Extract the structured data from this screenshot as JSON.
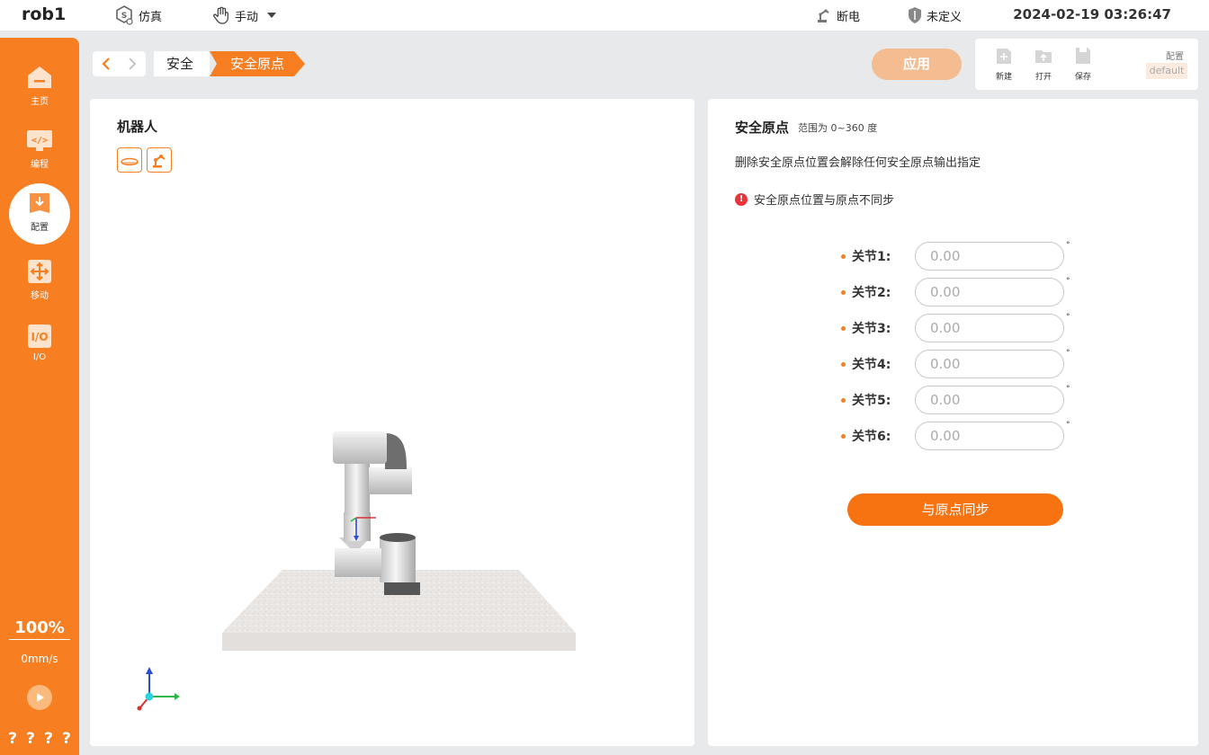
{
  "topbar": {
    "robot_name": "rob1",
    "mode_label": "仿真",
    "control_label": "手动",
    "power_label": "断电",
    "safety_label": "未定义",
    "datetime": "2024-02-19 03:26:47"
  },
  "sidebar": {
    "items": [
      {
        "label": "主页",
        "icon": "home-icon"
      },
      {
        "label": "编程",
        "icon": "code-icon"
      },
      {
        "label": "配置",
        "icon": "config-icon"
      },
      {
        "label": "移动",
        "icon": "move-icon"
      },
      {
        "label": "I/O",
        "icon": "io-icon"
      }
    ],
    "active_index": 2,
    "speed_percent": "100%",
    "speed_mm": "0mm/s",
    "footer_marks": [
      "?",
      "?",
      "?",
      "?"
    ]
  },
  "breadcrumb": {
    "items": [
      "安全",
      "安全原点"
    ]
  },
  "toolbar": {
    "apply_label": "应用",
    "new_label": "新建",
    "open_label": "打开",
    "save_label": "保存",
    "config_label": "配置",
    "config_value": "default"
  },
  "robot_panel": {
    "title": "机器人"
  },
  "safe_home": {
    "title": "安全原点",
    "range_note": "范围为 0~360 度",
    "description": "删除安全原点位置会解除任何安全原点输出指定",
    "warning": "安全原点位置与原点不同步",
    "warning_mark": "!",
    "degree_unit": "°",
    "joints": [
      {
        "label": "关节1:",
        "placeholder": "0.00"
      },
      {
        "label": "关节2:",
        "placeholder": "0.00"
      },
      {
        "label": "关节3:",
        "placeholder": "0.00"
      },
      {
        "label": "关节4:",
        "placeholder": "0.00"
      },
      {
        "label": "关节5:",
        "placeholder": "0.00"
      },
      {
        "label": "关节6:",
        "placeholder": "0.00"
      }
    ],
    "sync_label": "与原点同步"
  },
  "colors": {
    "accent": "#f77e21",
    "apply_disabled": "#f3bc91",
    "warning": "#e8343a"
  }
}
